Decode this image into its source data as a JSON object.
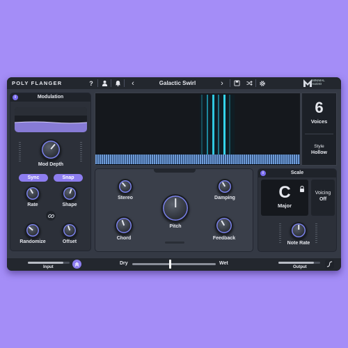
{
  "app": {
    "title": "POLY FLANGER",
    "brand_line1": "MINIMAL",
    "brand_line2": "AUDIO"
  },
  "topbar": {
    "help": "?",
    "preset_name": "Galactic Swirl",
    "prev": "‹",
    "next": "›"
  },
  "modulation": {
    "title": "Modulation",
    "mod_depth": "Mod Depth",
    "sync": "Sync",
    "snap": "Snap",
    "rate": "Rate",
    "shape": "Shape",
    "randomize": "Randomize",
    "offset": "Offset"
  },
  "display": {
    "voices_value": "6",
    "voices_label": "Voices",
    "style_label": "Style",
    "style_value": "Hollow"
  },
  "center": {
    "stereo": "Stereo",
    "damping": "Damping",
    "pitch": "Pitch",
    "chord": "Chord",
    "feedback": "Feedback"
  },
  "scale": {
    "title": "Scale",
    "key": "C",
    "mode": "Major",
    "voicing_label": "Voicing",
    "voicing_value": "Off",
    "note_rate": "Note Rate"
  },
  "bottom": {
    "input": "Input",
    "dry": "Dry",
    "wet": "Wet",
    "output": "Output",
    "dry_wet": 0.45,
    "input_level": 0.85,
    "output_level": 0.85
  }
}
